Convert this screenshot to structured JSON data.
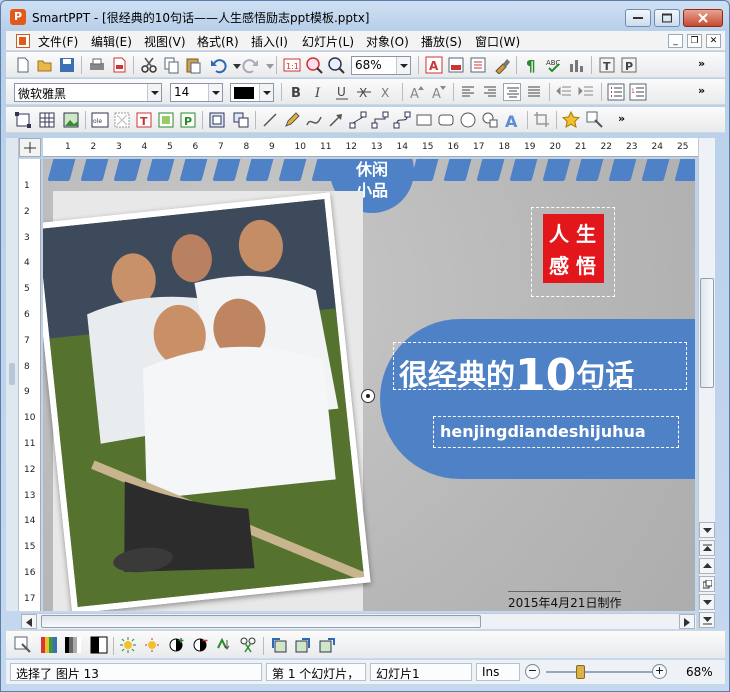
{
  "window": {
    "title": "SmartPPT - [很经典的10句话——人生感悟励志ppt模板.pptx]",
    "app_icon_letter": "P"
  },
  "menu": {
    "items": [
      "文件(F)",
      "编辑(E)",
      "视图(V)",
      "格式(R)",
      "插入(I)",
      "幻灯片(L)",
      "对象(O)",
      "播放(S)",
      "窗口(W)"
    ]
  },
  "toolbar1": {
    "zoom_value": "68%"
  },
  "toolbar2": {
    "font_name": "微软雅黑",
    "font_size": "14"
  },
  "ruler": {
    "h_ticks": [
      "1",
      "2",
      "3",
      "4",
      "5",
      "6",
      "7",
      "8",
      "9",
      "10",
      "11",
      "12",
      "13",
      "14",
      "15",
      "16",
      "17",
      "18",
      "19",
      "20",
      "21",
      "22",
      "23",
      "24",
      "25"
    ],
    "v_ticks": [
      "1",
      "2",
      "3",
      "4",
      "5",
      "6",
      "7",
      "8",
      "9",
      "10",
      "11",
      "12",
      "13",
      "14",
      "15",
      "16",
      "17"
    ]
  },
  "slide": {
    "hang_tag": [
      "休闲",
      "小品"
    ],
    "stamp": [
      "人",
      "生",
      "感",
      "悟"
    ],
    "title_prefix": "很经典的",
    "title_number": "10",
    "title_suffix": "句话",
    "pinyin": "henjingdiandeshijuhua",
    "date_credit": "2015年4月21日制作"
  },
  "status": {
    "selection": "选择了 图片 13",
    "slide_info": "第 1 个幻灯片，",
    "slide_name": "幻灯片1",
    "mode": "Ins",
    "zoom": "68%"
  },
  "colors": {
    "accent_blue": "#4f81c7",
    "stamp_red": "#e3161c"
  }
}
